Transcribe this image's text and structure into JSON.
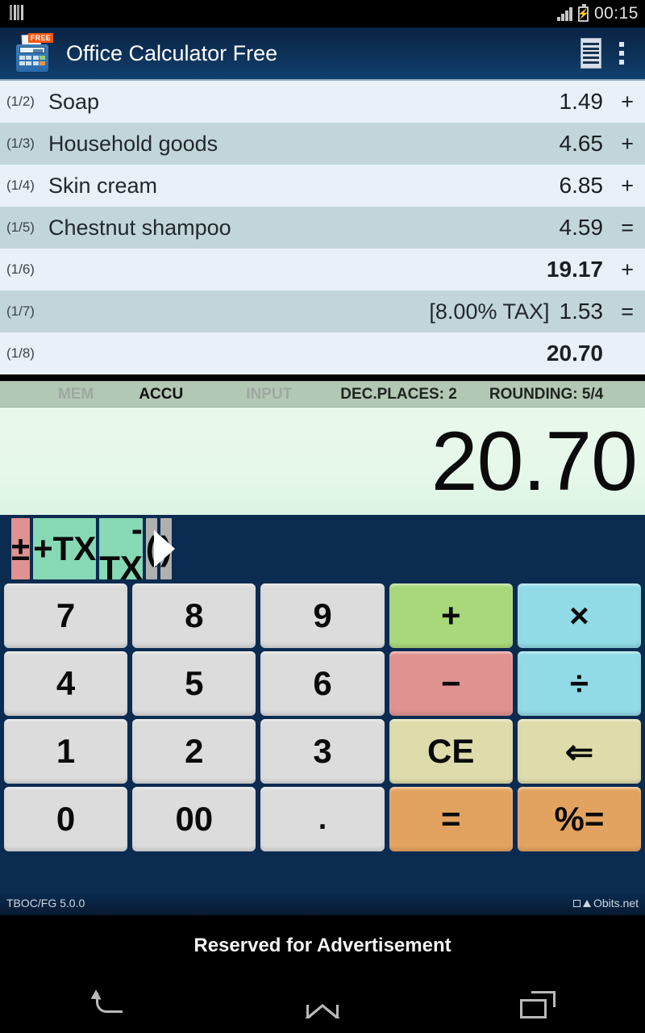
{
  "statusbar": {
    "left_icon": "vertical-bars-icon",
    "signal_icon": "signal-bars-icon",
    "battery_icon": "battery-charging-icon",
    "clock": "00:15"
  },
  "actionbar": {
    "app_icon": "office-calculator-app-icon",
    "badge": "FREE",
    "title": "Office Calculator Free",
    "tape_icon": "tape-list-icon",
    "overflow_icon": "overflow-menu-icon"
  },
  "tape": {
    "rows": [
      {
        "index": "(1/2)",
        "label": "Soap",
        "tax": "",
        "value": "1.49",
        "op": "+",
        "bold": false
      },
      {
        "index": "(1/3)",
        "label": "Household goods",
        "tax": "",
        "value": "4.65",
        "op": "+",
        "bold": false
      },
      {
        "index": "(1/4)",
        "label": "Skin cream",
        "tax": "",
        "value": "6.85",
        "op": "+",
        "bold": false
      },
      {
        "index": "(1/5)",
        "label": "Chestnut shampoo",
        "tax": "",
        "value": "4.59",
        "op": "=",
        "bold": false
      },
      {
        "index": "(1/6)",
        "label": "",
        "tax": "",
        "value": "19.17",
        "op": "+",
        "bold": true
      },
      {
        "index": "(1/7)",
        "label": "",
        "tax": "[8.00% TAX]",
        "value": "1.53",
        "op": "=",
        "bold": false
      },
      {
        "index": "(1/8)",
        "label": "",
        "tax": "",
        "value": "20.70",
        "op": "",
        "bold": true
      }
    ]
  },
  "modebar": {
    "mem": "MEM",
    "accu": "ACCU",
    "input": "INPUT",
    "dec_places": "DEC.PLACES: 2",
    "rounding": "ROUNDING: 5/4",
    "active": "ACCU"
  },
  "display": {
    "value": "20.70"
  },
  "keypad": {
    "row1": [
      {
        "label": "±",
        "style": "k-red"
      },
      {
        "label": "+TX",
        "style": "k-teal"
      },
      {
        "label": "-TX",
        "style": "k-teal"
      },
      {
        "label": "(",
        "style": "k-gray"
      },
      {
        "label": ")",
        "style": "k-gray"
      }
    ],
    "next_page_icon": "next-page-arrow-icon",
    "row2": [
      {
        "label": "7",
        "style": "k-num"
      },
      {
        "label": "8",
        "style": "k-num"
      },
      {
        "label": "9",
        "style": "k-num"
      },
      {
        "label": "+",
        "style": "k-green"
      },
      {
        "label": "×",
        "style": "k-cyan"
      }
    ],
    "row3": [
      {
        "label": "4",
        "style": "k-num"
      },
      {
        "label": "5",
        "style": "k-num"
      },
      {
        "label": "6",
        "style": "k-num"
      },
      {
        "label": "−",
        "style": "k-red"
      },
      {
        "label": "÷",
        "style": "k-cyan"
      }
    ],
    "row4": [
      {
        "label": "1",
        "style": "k-num"
      },
      {
        "label": "2",
        "style": "k-num"
      },
      {
        "label": "3",
        "style": "k-num"
      },
      {
        "label": "CE",
        "style": "k-khaki"
      },
      {
        "label": "⇐",
        "style": "k-khaki"
      }
    ],
    "row5": [
      {
        "label": "0",
        "style": "k-num"
      },
      {
        "label": "00",
        "style": "k-num"
      },
      {
        "label": ".",
        "style": "k-num"
      },
      {
        "label": "=",
        "style": "k-orange"
      },
      {
        "label": "%=",
        "style": "k-orange"
      }
    ]
  },
  "footer": {
    "version": "TBOC/FG 5.0.0",
    "brand": "Obits.net"
  },
  "ad": {
    "text": "Reserved for Advertisement"
  },
  "navbar": {
    "back": "back-nav-icon",
    "home": "home-nav-icon",
    "recents": "recent-apps-nav-icon"
  },
  "colors": {
    "actionbar": "#0d2f55",
    "keypad_bg": "#0b2b50",
    "display_bg": "#e6f8ea",
    "modebar_bg": "#b3c8b4",
    "row_odd": "#e9f0f8",
    "row_even": "#c2d6da"
  }
}
